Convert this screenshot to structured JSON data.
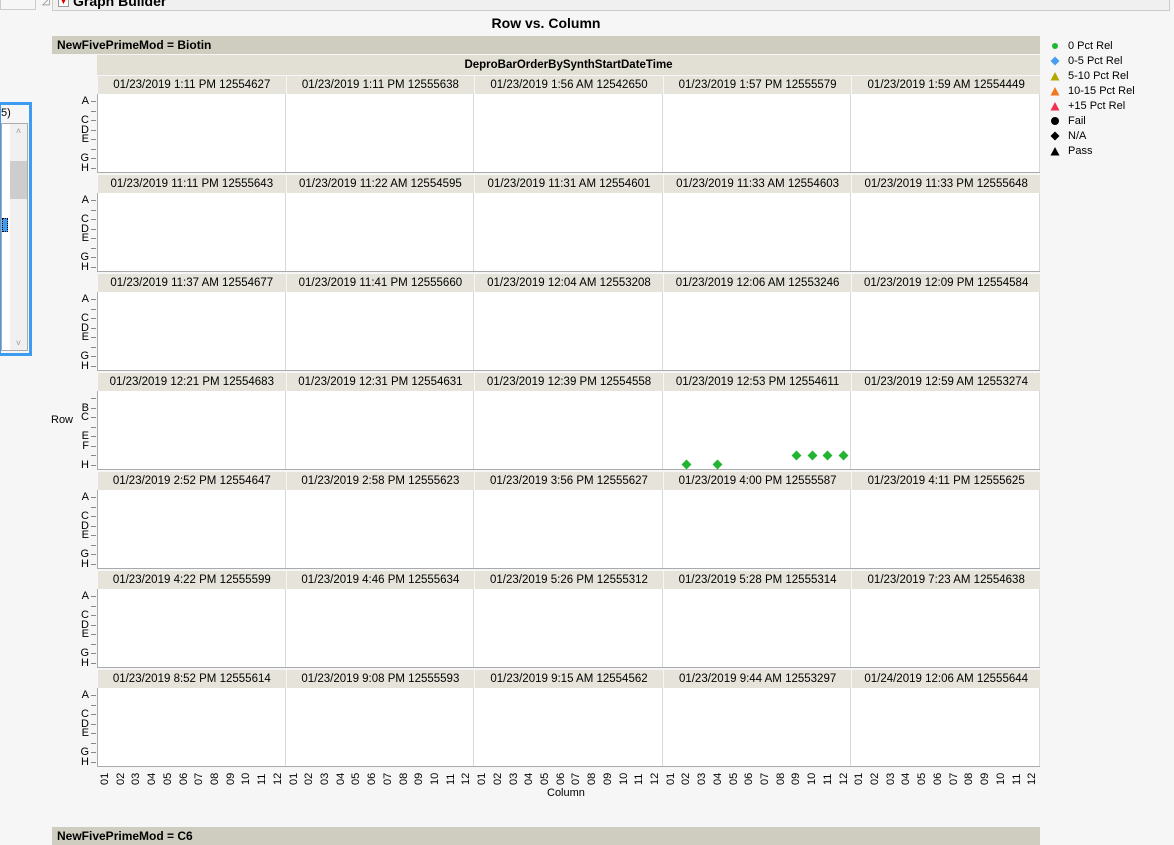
{
  "window": {
    "title": "Graph Builder"
  },
  "left_list": {
    "count_fragment": "5)",
    "scroll_up": "˄",
    "scroll_down": "˅"
  },
  "chart_data": {
    "type": "scatter",
    "title": "Row vs. Column",
    "group_header": "NewFivePrimeMod = Biotin",
    "next_group_header": "NewFivePrimeMod = C6",
    "wrap_label": "DeproBarOrderBySynthStartDateTime",
    "xlabel": "Column",
    "ylabel": "Row",
    "x_ticks": [
      "01",
      "02",
      "03",
      "04",
      "05",
      "06",
      "07",
      "08",
      "09",
      "10",
      "11",
      "12"
    ],
    "y_categories": [
      "A",
      "B",
      "C",
      "D",
      "E",
      "F",
      "G",
      "H"
    ],
    "y_tick_labels_default": [
      "A",
      "",
      "C",
      "D",
      "E",
      "",
      "G",
      "H"
    ],
    "y_tick_labels_row4": [
      "",
      "B",
      "C",
      "",
      "E",
      "F",
      "",
      "H"
    ],
    "panels": [
      "01/23/2019 1:11 PM 12554627",
      "01/23/2019 1:11 PM 12555638",
      "01/23/2019 1:56 AM 12542650",
      "01/23/2019 1:57 PM 12555579",
      "01/23/2019 1:59 AM 12554449",
      "01/23/2019 11:11 PM 12555643",
      "01/23/2019 11:22 AM 12554595",
      "01/23/2019 11:31 AM 12554601",
      "01/23/2019 11:33 AM 12554603",
      "01/23/2019 11:33 PM 12555648",
      "01/23/2019 11:37 AM 12554677",
      "01/23/2019 11:41 PM 12555660",
      "01/23/2019 12:04 AM 12553208",
      "01/23/2019 12:06 AM 12553246",
      "01/23/2019 12:09 PM 12554584",
      "01/23/2019 12:21 PM 12554683",
      "01/23/2019 12:31 PM 12554631",
      "01/23/2019 12:39 PM 12554558",
      "01/23/2019 12:53 PM 12554611",
      "01/23/2019 12:59 AM 12553274",
      "01/23/2019 2:52 PM 12554647",
      "01/23/2019 2:58 PM 12555623",
      "01/23/2019 3:56 PM 12555627",
      "01/23/2019 4:00 PM 12555587",
      "01/23/2019 4:11 PM 12555625",
      "01/23/2019 4:22 PM 12555599",
      "01/23/2019 4:46 PM 12555634",
      "01/23/2019 5:26 PM 12555312",
      "01/23/2019 5:28 PM 12555314",
      "01/23/2019 7:23 AM 12554638",
      "01/23/2019 8:52 PM 12555614",
      "01/23/2019 9:08 PM 12555593",
      "01/23/2019 9:15 AM 12554562",
      "01/23/2019 9:44 AM 12553297",
      "01/24/2019 12:06 AM 12555644"
    ],
    "points": [
      {
        "panel": "01/23/2019 12:53 PM 12554611",
        "x": "02",
        "y": "H",
        "legend": "0 Pct Rel",
        "shape": "diamond"
      },
      {
        "panel": "01/23/2019 12:53 PM 12554611",
        "x": "04",
        "y": "H",
        "legend": "0 Pct Rel",
        "shape": "diamond"
      },
      {
        "panel": "01/23/2019 12:53 PM 12554611",
        "x": "09",
        "y": "G",
        "legend": "0 Pct Rel",
        "shape": "diamond"
      },
      {
        "panel": "01/23/2019 12:53 PM 12554611",
        "x": "10",
        "y": "G",
        "legend": "0 Pct Rel",
        "shape": "diamond"
      },
      {
        "panel": "01/23/2019 12:53 PM 12554611",
        "x": "11",
        "y": "G",
        "legend": "0 Pct Rel",
        "shape": "diamond"
      },
      {
        "panel": "01/23/2019 12:53 PM 12554611",
        "x": "12",
        "y": "G",
        "legend": "0 Pct Rel",
        "shape": "diamond"
      }
    ],
    "legend": [
      {
        "label": "0 Pct Rel",
        "shape": "circle",
        "color": "#22b531"
      },
      {
        "label": "0-5 Pct Rel",
        "shape": "diamond",
        "color": "#4a9ef0"
      },
      {
        "label": "5-10 Pct Rel",
        "shape": "triangle",
        "color": "#b3a800"
      },
      {
        "label": "10-15 Pct Rel",
        "shape": "triangle",
        "color": "#f07820"
      },
      {
        "label": "+15 Pct Rel",
        "shape": "triangle",
        "color": "#f03050"
      },
      {
        "label": "Fail",
        "shape": "circle",
        "color": "#000000"
      },
      {
        "label": "N/A",
        "shape": "diamond",
        "color": "#000000"
      },
      {
        "label": "Pass",
        "shape": "triangle",
        "color": "#000000"
      }
    ],
    "legend_placement": "right",
    "grid": false
  }
}
